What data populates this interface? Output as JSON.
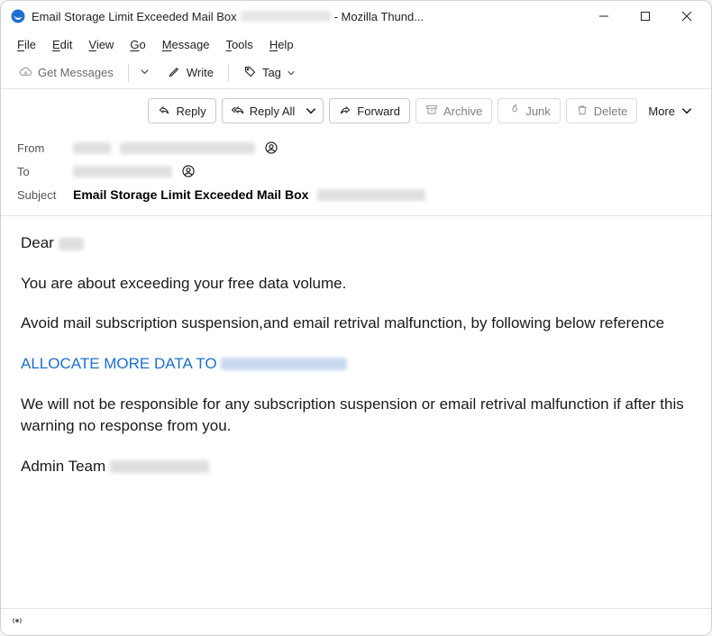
{
  "window": {
    "title_prefix": "Email Storage Limit Exceeded Mail Box",
    "title_suffix": "- Mozilla Thund..."
  },
  "menubar": [
    "File",
    "Edit",
    "View",
    "Go",
    "Message",
    "Tools",
    "Help"
  ],
  "toolbar1": {
    "get_messages": "Get Messages",
    "write": "Write",
    "tag": "Tag"
  },
  "actions": {
    "reply": "Reply",
    "reply_all": "Reply All",
    "forward": "Forward",
    "archive": "Archive",
    "junk": "Junk",
    "delete": "Delete",
    "more": "More"
  },
  "headers": {
    "from_label": "From",
    "to_label": "To",
    "subject_label": "Subject",
    "subject_value": "Email Storage Limit Exceeded Mail Box"
  },
  "body": {
    "greeting": "Dear",
    "line1": "You are about exceeding your free data volume.",
    "line2": "Avoid mail subscription suspension,and email retrival malfunction, by following below reference",
    "link_text": "ALLOCATE MORE DATA TO",
    "line3": "We will not be responsible for any subscription suspension or email retrival malfunction if after this warning no response from you.",
    "signoff": "Admin Team"
  }
}
